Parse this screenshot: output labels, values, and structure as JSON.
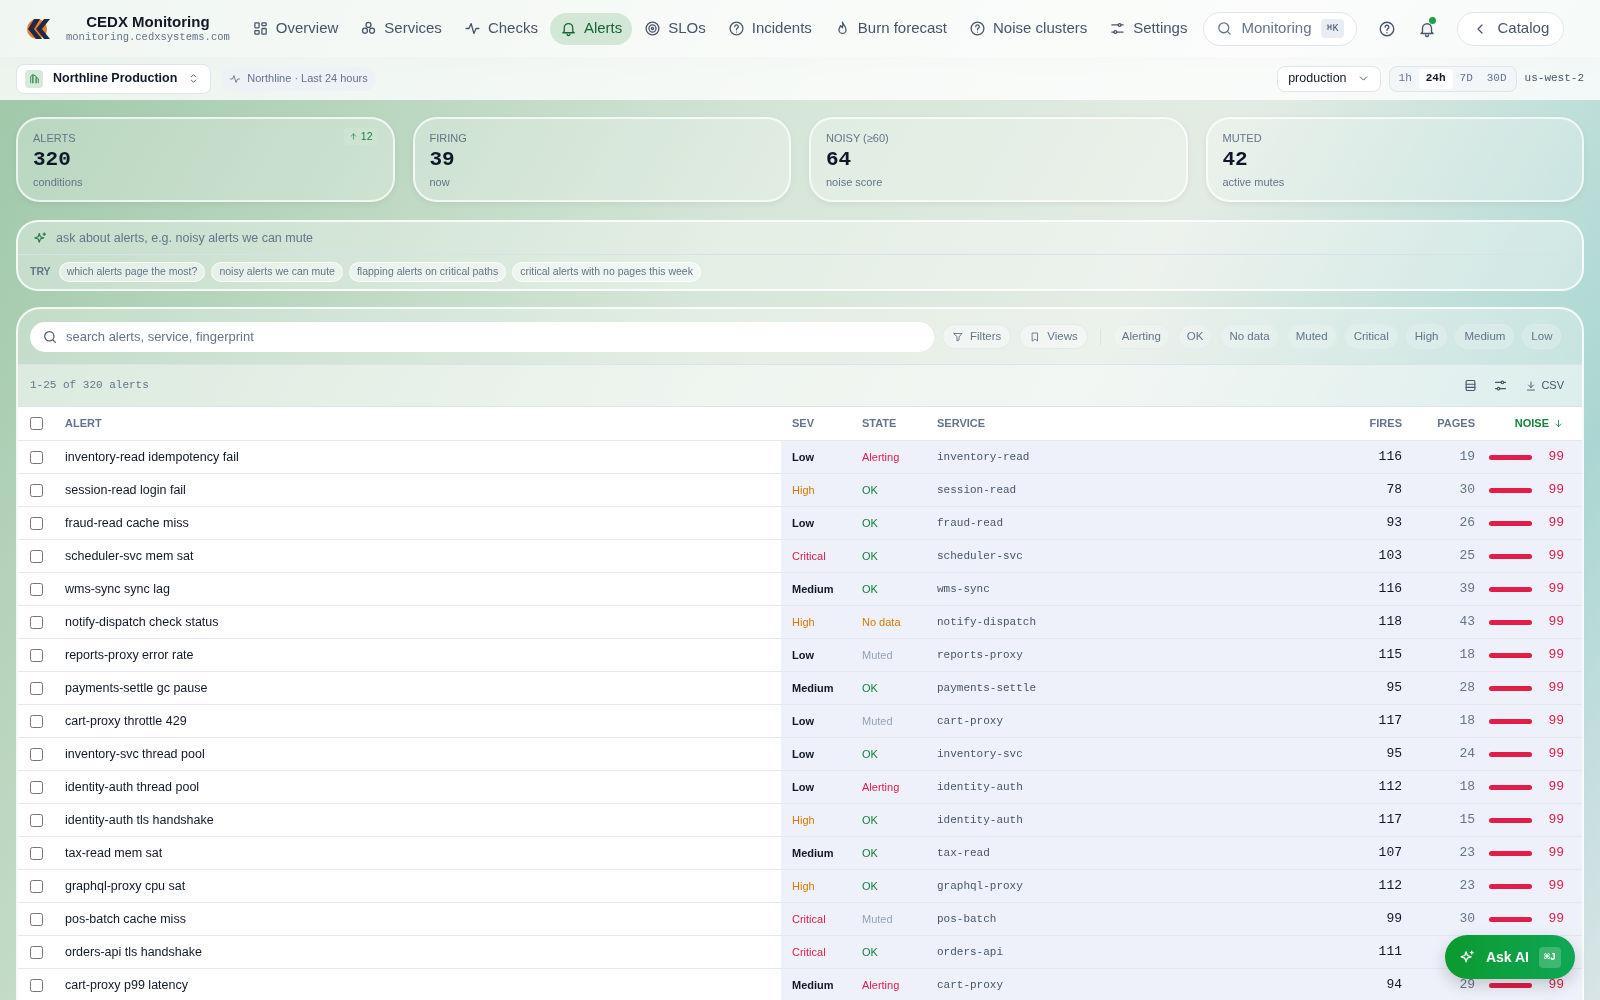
{
  "brand": {
    "name": "CEDX Monitoring",
    "domain": "monitoring.cedxsystems.com"
  },
  "nav": [
    {
      "label": "Overview",
      "selected": false
    },
    {
      "label": "Services",
      "selected": false
    },
    {
      "label": "Checks",
      "selected": false
    },
    {
      "label": "Alerts",
      "selected": true
    },
    {
      "label": "SLOs",
      "selected": false
    },
    {
      "label": "Incidents",
      "selected": false
    },
    {
      "label": "Burn forecast",
      "selected": false
    },
    {
      "label": "Noise clusters",
      "selected": false
    },
    {
      "label": "Settings",
      "selected": false
    }
  ],
  "search": {
    "label": "Monitoring",
    "shortcut": "⌘K"
  },
  "catalog": "Catalog",
  "workspace": "Northline Production",
  "context": "Northline · Last 24 hours",
  "environment": "production",
  "ranges": [
    {
      "label": "1h",
      "selected": false
    },
    {
      "label": "24h",
      "selected": true
    },
    {
      "label": "7D",
      "selected": false
    },
    {
      "label": "30D",
      "selected": false
    }
  ],
  "region": "us-west-2",
  "stats": [
    {
      "label": "ALERTS",
      "value": "320",
      "sub": "conditions",
      "delta": "12"
    },
    {
      "label": "FIRING",
      "value": "39",
      "sub": "now"
    },
    {
      "label": "NOISY (≥60)",
      "value": "64",
      "sub": "noise score"
    },
    {
      "label": "MUTED",
      "value": "42",
      "sub": "active mutes"
    }
  ],
  "ask": {
    "placeholder": "ask about alerts, e.g. noisy alerts we can mute",
    "try_label": "TRY",
    "suggestions": [
      "which alerts page the most?",
      "noisy alerts we can mute",
      "flapping alerts on critical paths",
      "critical alerts with no pages this week"
    ]
  },
  "table_search": {
    "placeholder": "search alerts, service, fingerprint"
  },
  "toolbar": {
    "filters": "Filters",
    "views": "Views",
    "chips": [
      {
        "label": "Alerting",
        "selected": false
      },
      {
        "label": "OK",
        "selected": false
      },
      {
        "label": "No data",
        "selected": false
      },
      {
        "label": "Muted",
        "selected": false
      },
      {
        "label": "Critical",
        "selected": false
      },
      {
        "label": "High",
        "selected": false
      },
      {
        "label": "Medium",
        "selected": false
      },
      {
        "label": "Low",
        "selected": false
      }
    ]
  },
  "count": "1-25 of 320 alerts",
  "csv": "CSV",
  "select_all": {
    "checked": false
  },
  "columns": [
    "ALERT",
    "SEV",
    "STATE",
    "SERVICE",
    "FIRES",
    "PAGES",
    "NOISE"
  ],
  "rows": [
    {
      "alert": "inventory-read idempotency fail",
      "severity": {
        "label": "Low",
        "kind": "low"
      },
      "state": {
        "label": "Alerting",
        "kind": "alerting"
      },
      "service": "inventory-read",
      "fires": "116",
      "pages": "19",
      "noise": "99",
      "level": 0.99,
      "checked": false
    },
    {
      "alert": "session-read login fail",
      "severity": {
        "label": "High",
        "kind": "high"
      },
      "state": {
        "label": "OK",
        "kind": "ok"
      },
      "service": "session-read",
      "fires": "78",
      "pages": "30",
      "noise": "99",
      "level": 0.99,
      "checked": false
    },
    {
      "alert": "fraud-read cache miss",
      "severity": {
        "label": "Low",
        "kind": "low"
      },
      "state": {
        "label": "OK",
        "kind": "ok"
      },
      "service": "fraud-read",
      "fires": "93",
      "pages": "26",
      "noise": "99",
      "level": 0.99,
      "checked": false
    },
    {
      "alert": "scheduler-svc mem sat",
      "severity": {
        "label": "Critical",
        "kind": "critical"
      },
      "state": {
        "label": "OK",
        "kind": "ok"
      },
      "service": "scheduler-svc",
      "fires": "103",
      "pages": "25",
      "noise": "99",
      "level": 0.99,
      "checked": false
    },
    {
      "alert": "wms-sync sync lag",
      "severity": {
        "label": "Medium",
        "kind": "medium"
      },
      "state": {
        "label": "OK",
        "kind": "ok"
      },
      "service": "wms-sync",
      "fires": "116",
      "pages": "39",
      "noise": "99",
      "level": 0.99,
      "checked": false
    },
    {
      "alert": "notify-dispatch check status",
      "severity": {
        "label": "High",
        "kind": "high"
      },
      "state": {
        "label": "No data",
        "kind": "nodata"
      },
      "service": "notify-dispatch",
      "fires": "118",
      "pages": "43",
      "noise": "99",
      "level": 0.99,
      "checked": false
    },
    {
      "alert": "reports-proxy error rate",
      "severity": {
        "label": "Low",
        "kind": "low"
      },
      "state": {
        "label": "Muted",
        "kind": "muted"
      },
      "service": "reports-proxy",
      "fires": "115",
      "pages": "18",
      "noise": "99",
      "level": 0.99,
      "checked": false
    },
    {
      "alert": "payments-settle gc pause",
      "severity": {
        "label": "Medium",
        "kind": "medium"
      },
      "state": {
        "label": "OK",
        "kind": "ok"
      },
      "service": "payments-settle",
      "fires": "95",
      "pages": "28",
      "noise": "99",
      "level": 0.99,
      "checked": false
    },
    {
      "alert": "cart-proxy throttle 429",
      "severity": {
        "label": "Low",
        "kind": "low"
      },
      "state": {
        "label": "Muted",
        "kind": "muted"
      },
      "service": "cart-proxy",
      "fires": "117",
      "pages": "18",
      "noise": "99",
      "level": 0.99,
      "checked": false
    },
    {
      "alert": "inventory-svc thread pool",
      "severity": {
        "label": "Low",
        "kind": "low"
      },
      "state": {
        "label": "OK",
        "kind": "ok"
      },
      "service": "inventory-svc",
      "fires": "95",
      "pages": "24",
      "noise": "99",
      "level": 0.99,
      "checked": false
    },
    {
      "alert": "identity-auth thread pool",
      "severity": {
        "label": "Low",
        "kind": "low"
      },
      "state": {
        "label": "Alerting",
        "kind": "alerting"
      },
      "service": "identity-auth",
      "fires": "112",
      "pages": "18",
      "noise": "99",
      "level": 0.99,
      "checked": false
    },
    {
      "alert": "identity-auth tls handshake",
      "severity": {
        "label": "High",
        "kind": "high"
      },
      "state": {
        "label": "OK",
        "kind": "ok"
      },
      "service": "identity-auth",
      "fires": "117",
      "pages": "15",
      "noise": "99",
      "level": 0.99,
      "checked": false
    },
    {
      "alert": "tax-read mem sat",
      "severity": {
        "label": "Medium",
        "kind": "medium"
      },
      "state": {
        "label": "OK",
        "kind": "ok"
      },
      "service": "tax-read",
      "fires": "107",
      "pages": "23",
      "noise": "99",
      "level": 0.99,
      "checked": false
    },
    {
      "alert": "graphql-proxy cpu sat",
      "severity": {
        "label": "High",
        "kind": "high"
      },
      "state": {
        "label": "OK",
        "kind": "ok"
      },
      "service": "graphql-proxy",
      "fires": "112",
      "pages": "23",
      "noise": "99",
      "level": 0.99,
      "checked": false
    },
    {
      "alert": "pos-batch cache miss",
      "severity": {
        "label": "Critical",
        "kind": "critical"
      },
      "state": {
        "label": "Muted",
        "kind": "muted"
      },
      "service": "pos-batch",
      "fires": "99",
      "pages": "30",
      "noise": "99",
      "level": 0.99,
      "checked": false
    },
    {
      "alert": "orders-api tls handshake",
      "severity": {
        "label": "Critical",
        "kind": "critical"
      },
      "state": {
        "label": "OK",
        "kind": "ok"
      },
      "service": "orders-api",
      "fires": "111",
      "checked": false
    },
    {
      "alert": "cart-proxy p99 latency",
      "severity": {
        "label": "Medium",
        "kind": "medium"
      },
      "state": {
        "label": "Alerting",
        "kind": "alerting"
      },
      "service": "cart-proxy",
      "fires": "94",
      "pages": "29",
      "noise": "99",
      "level": 0.99,
      "checked": false
    }
  ],
  "ask_ai": {
    "label": "Ask AI",
    "shortcut": "⌘J"
  }
}
